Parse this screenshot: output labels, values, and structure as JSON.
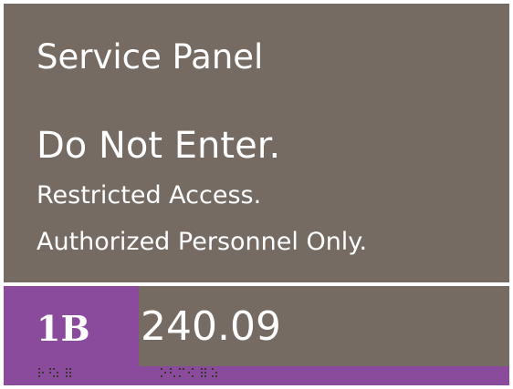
{
  "sign": {
    "title": "Service Panel",
    "warning": "Do Not Enter.",
    "line2": "Restricted Access.",
    "line3": "Authorized Personnel Only.",
    "room_id": "1B",
    "room_number": "240.09",
    "colors": {
      "panel": "#756b63",
      "accent": "#8a4b9c",
      "text": "#ffffff",
      "braille": "#3b3330"
    }
  }
}
